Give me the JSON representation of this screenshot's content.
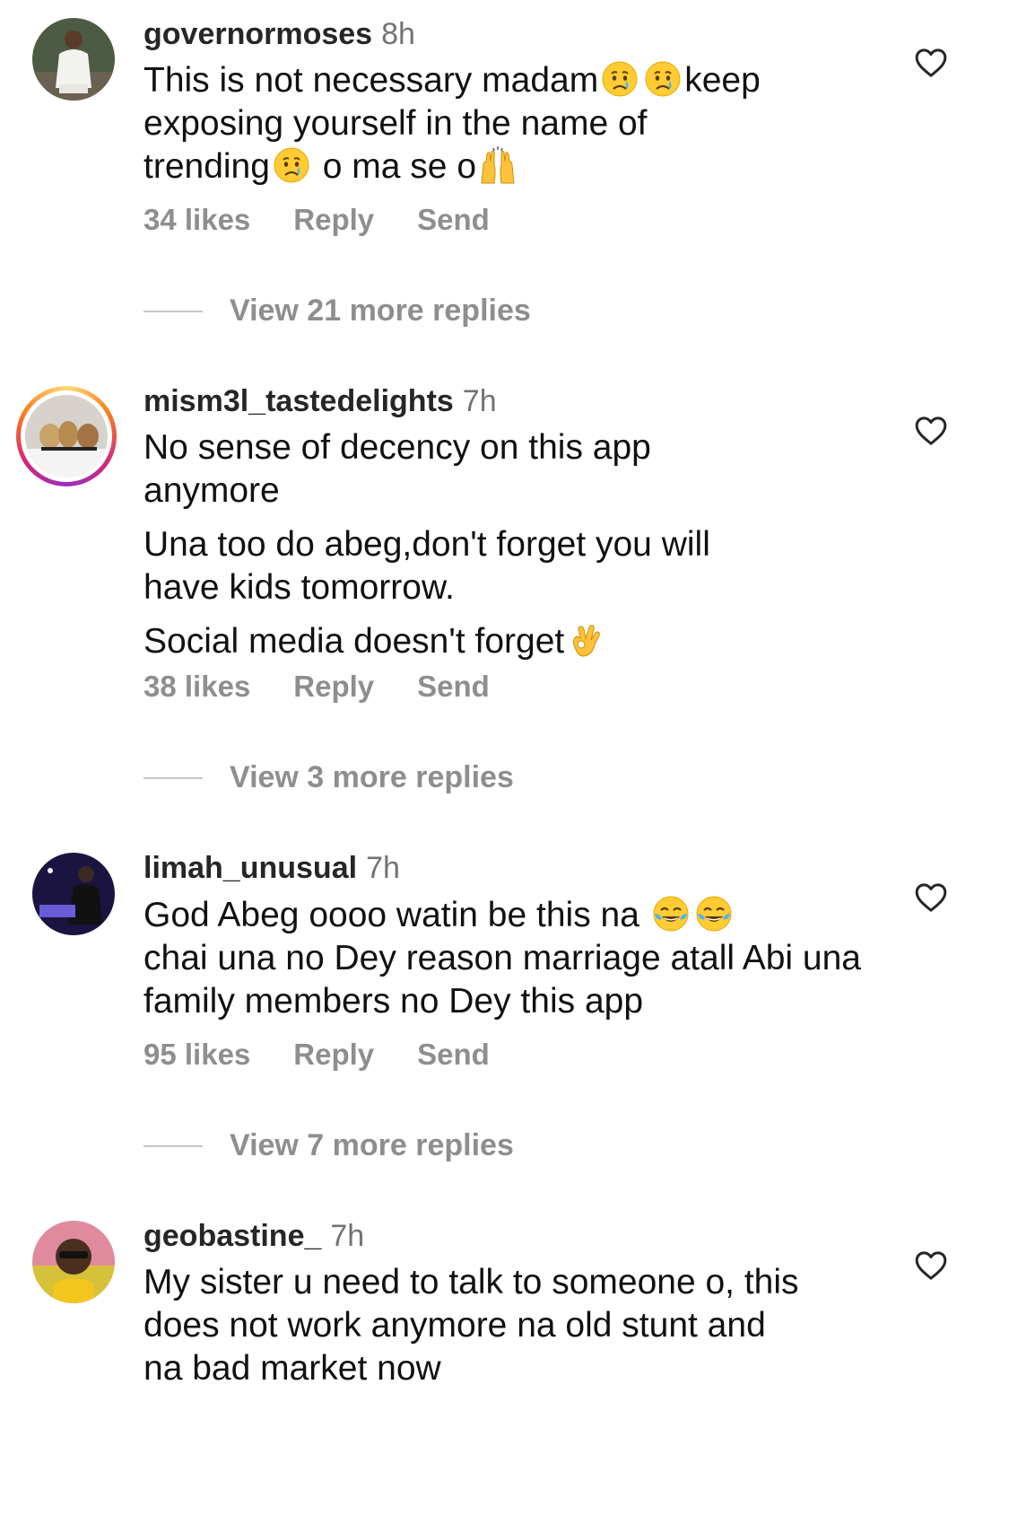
{
  "comments": [
    {
      "username": "governormoses",
      "time": "8h",
      "text_parts": [
        "This is not necessary madam",
        "keep",
        "exposing yourself in the name of",
        "trending",
        " o ma se o"
      ],
      "likes": "34 likes",
      "reply": "Reply",
      "send": "Send",
      "view_more": "View 21 more replies"
    },
    {
      "username": "mism3l_tastedelights",
      "time": "7h",
      "lines": [
        "No sense of decency on this app anymore",
        "Una too do abeg,don't forget you will have kids tomorrow.",
        "Social media doesn't forget"
      ],
      "likes": "38 likes",
      "reply": "Reply",
      "send": "Send",
      "view_more": "View 3 more replies"
    },
    {
      "username": "limah_unusual",
      "time": "7h",
      "text_parts": [
        "God Abeg oooo watin be this na ",
        "chai una no Dey reason marriage atall Abi una family members no Dey this app"
      ],
      "likes": "95 likes",
      "reply": "Reply",
      "send": "Send",
      "view_more": "View 7 more replies"
    },
    {
      "username": "geobastine_",
      "time": "7h",
      "text": "My sister u need to talk to someone o, this does not work anymore na old stunt and na bad market now"
    }
  ],
  "icons": {
    "heart": "heart-outline-icon",
    "crying": "crying-face-emoji",
    "raised_hands": "raising-hands-emoji",
    "ok_hand": "ok-hand-emoji",
    "tears_of_joy": "face-with-tears-of-joy-emoji"
  }
}
